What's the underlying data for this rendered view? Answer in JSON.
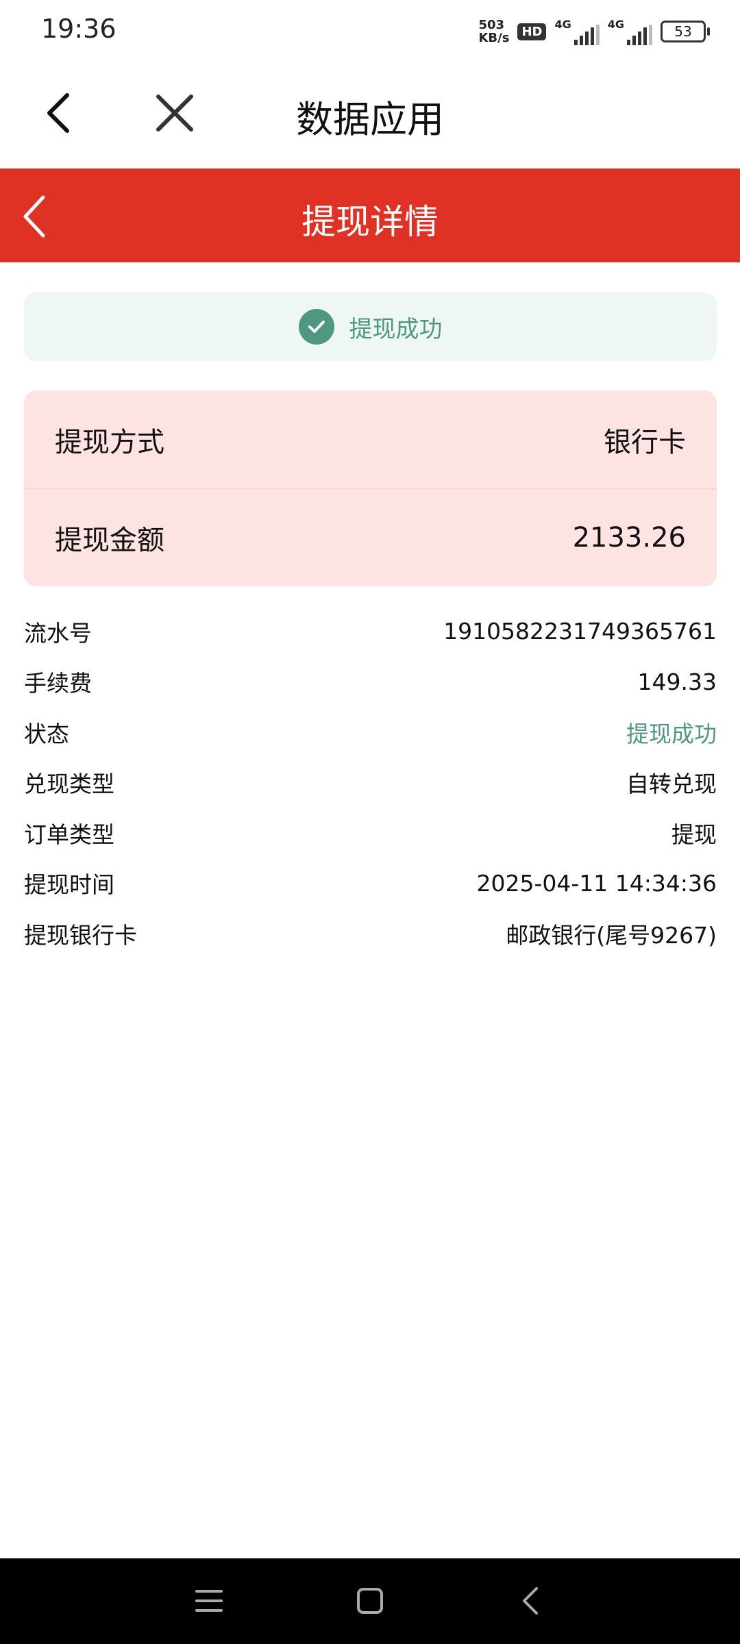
{
  "status_bar": {
    "time": "19:36",
    "speed_value": "503",
    "speed_unit": "KB/s",
    "hd_label": "HD",
    "network_1": "4G",
    "network_2": "4G",
    "battery": "53"
  },
  "app_header": {
    "title": "数据应用",
    "back_icon": "chevron-left-icon",
    "close_icon": "close-icon"
  },
  "page_header": {
    "title": "提现详情",
    "back_icon": "chevron-left-icon",
    "color": "#e03224"
  },
  "status_banner": {
    "text": "提现成功",
    "icon": "check-circle-icon",
    "color": "#4e9780"
  },
  "summary": {
    "method_label": "提现方式",
    "method_value": "银行卡",
    "amount_label": "提现金额",
    "amount_value": "2133.26"
  },
  "details": [
    {
      "label": "流水号",
      "value": "1910582231749365761"
    },
    {
      "label": "手续费",
      "value": "149.33"
    },
    {
      "label": "状态",
      "value": "提现成功"
    },
    {
      "label": "兑现类型",
      "value": "自转兑现"
    },
    {
      "label": "订单类型",
      "value": "提现"
    },
    {
      "label": "提现时间",
      "value": "2025-04-11 14:34:36"
    },
    {
      "label": "提现银行卡",
      "value": "邮政银行(尾号9267)"
    }
  ],
  "nav_bar": {
    "menu_icon": "menu-icon",
    "home_icon": "home-icon",
    "back_icon": "back-icon"
  }
}
